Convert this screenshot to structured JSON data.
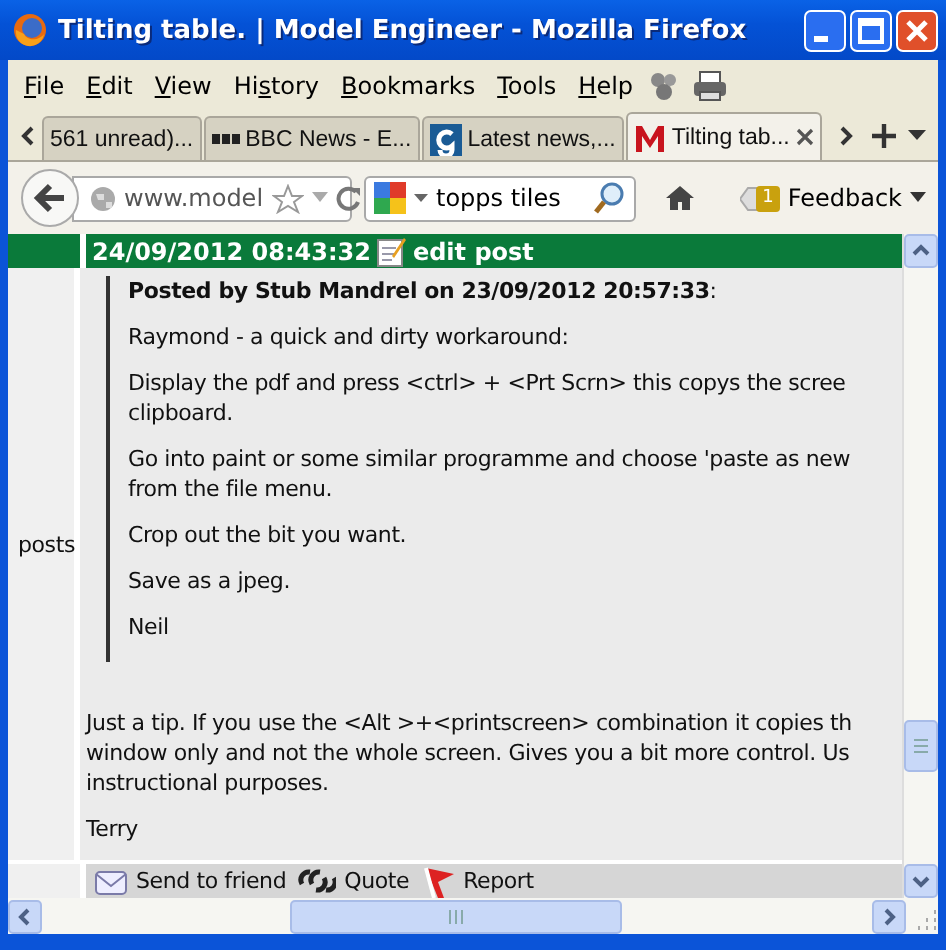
{
  "window": {
    "title": "Tilting table. | Model Engineer - Mozilla Firefox"
  },
  "menu": [
    {
      "access_key": "F",
      "after": "ile"
    },
    {
      "access_key": "E",
      "after": "dit"
    },
    {
      "access_key": "V",
      "after": "iew"
    },
    {
      "before": "Hi",
      "access_key": "s",
      "after": "tory"
    },
    {
      "access_key": "B",
      "after": "ookmarks"
    },
    {
      "access_key": "T",
      "after": "ools"
    },
    {
      "access_key": "H",
      "after": "elp"
    }
  ],
  "tabs": [
    {
      "label": "561 unread)...",
      "kind": "plain",
      "selected": false
    },
    {
      "label": "BBC News - E...",
      "kind": "bbc",
      "selected": false
    },
    {
      "label": "Latest news,...",
      "kind": "g",
      "selected": false
    },
    {
      "label": "Tilting tab...",
      "kind": "m",
      "selected": true
    }
  ],
  "navbar": {
    "url": "www.model",
    "search": "topps tiles",
    "badge": "1",
    "feedback": "Feedback"
  },
  "post": {
    "header_time": "24/09/2012 08:43:32",
    "edit": "edit post",
    "side_label": "posts",
    "quote": {
      "byline": "Posted by Stub Mandrel on 23/09/2012 20:57:33",
      "byline_tail": ":",
      "paragraphs": [
        "Raymond - a quick and dirty workaround:",
        "Display the pdf and press <ctrl> + <Prt Scrn> this copys the scree\nclipboard.",
        "Go into paint or some similar programme and choose 'paste as new\nfrom the file menu.",
        "Crop out the bit you want.",
        "Save as a jpeg.",
        "Neil"
      ]
    },
    "paragraphs": [
      "Just a tip. If you use the <Alt >+<printscreen> combination it copies th\nwindow only and not the whole screen. Gives you a bit more control. Us\ninstructional purposes.",
      "Terry"
    ],
    "actions": [
      {
        "label": "Send to friend",
        "kind": "mail"
      },
      {
        "label": "Quote",
        "kind": "quote"
      },
      {
        "label": "Report",
        "kind": "flag"
      }
    ]
  }
}
